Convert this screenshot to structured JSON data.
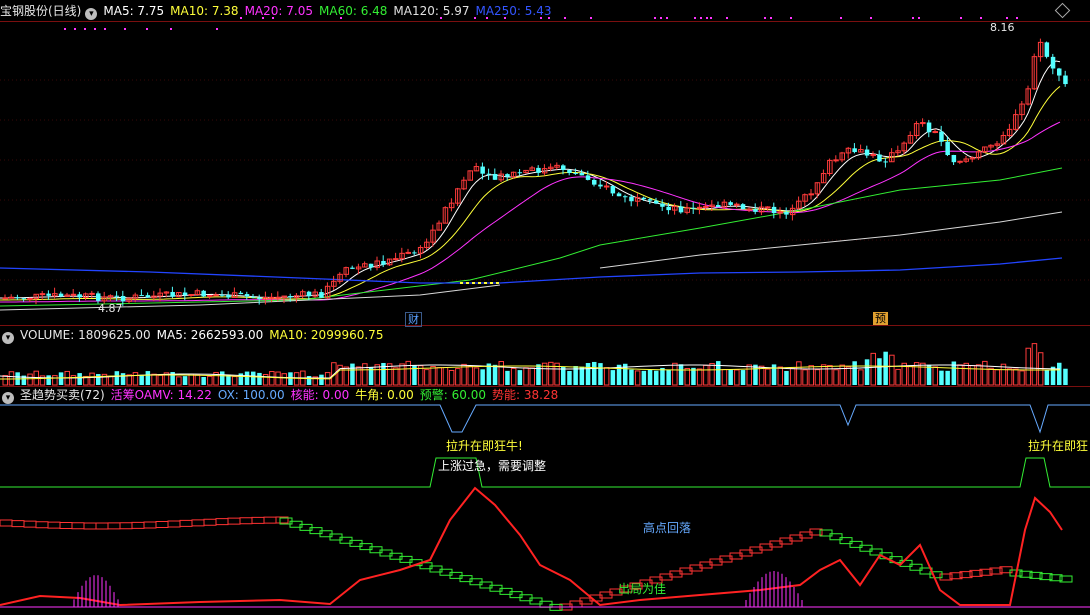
{
  "main": {
    "title": "宝钢股份(日线)",
    "ma": [
      {
        "label": "MA5: 7.75",
        "color": "#ffffff"
      },
      {
        "label": "MA10: 7.38",
        "color": "#ffff3a"
      },
      {
        "label": "MA20: 7.05",
        "color": "#ff33ff"
      },
      {
        "label": "MA60: 6.48",
        "color": "#33ee33"
      },
      {
        "label": "MA120: 5.97",
        "color": "#e0e0e0"
      },
      {
        "label": "MA250: 5.43",
        "color": "#3355ff"
      }
    ],
    "high_label": "8.16",
    "low_label": "4.87",
    "tag_cai": "财",
    "tag_yu": "预"
  },
  "volume": {
    "items": [
      {
        "label": "VOLUME: 1809625.00",
        "color": "#e8e8e8"
      },
      {
        "label": "MA5: 2662593.00",
        "color": "#ffffff"
      },
      {
        "label": "MA10: 2099960.75",
        "color": "#ffff3a"
      }
    ]
  },
  "indicator": {
    "items": [
      {
        "label": "圣趋势买卖(72)",
        "color": "#e8e8e8"
      },
      {
        "label": "活筹OAMV: 14.22",
        "color": "#ff33ff"
      },
      {
        "label": "OX: 100.00",
        "color": "#66aaff"
      },
      {
        "label": "核能: 0.00",
        "color": "#ff33ff"
      },
      {
        "label": "牛角: 0.00",
        "color": "#ffff3a"
      },
      {
        "label": "预警: 60.00",
        "color": "#33ee33"
      },
      {
        "label": "势能: 38.28",
        "color": "#ff3333"
      }
    ],
    "annotations": {
      "pull_up_1": "拉升在即狂牛!",
      "pull_up_2": "拉升在即狂",
      "overheat": "上涨过急，需要调整",
      "high_fall": "高点回落",
      "exit": "出局为佳"
    }
  },
  "colors": {
    "up": "#ff3b3b",
    "down": "#54ffff",
    "separator": "#7a0f0f"
  }
}
